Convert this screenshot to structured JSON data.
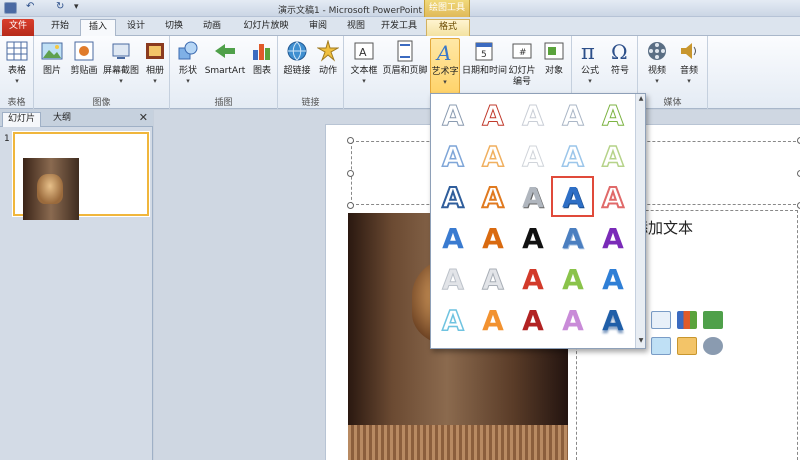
{
  "window": {
    "title": "演示文稿1 - Microsoft PowerPoint",
    "context_tab_group": "绘图工具"
  },
  "tabs": [
    "文件",
    "开始",
    "插入",
    "设计",
    "切换",
    "动画",
    "幻灯片放映",
    "审阅",
    "视图",
    "开发工具",
    "格式"
  ],
  "ribbon": {
    "groups": [
      {
        "label": "表格",
        "buttons": [
          "表格"
        ]
      },
      {
        "label": "图像",
        "buttons": [
          "图片",
          "剪贴画",
          "屏幕截图",
          "相册"
        ]
      },
      {
        "label": "插图",
        "buttons": [
          "形状",
          "SmartArt",
          "图表"
        ]
      },
      {
        "label": "链接",
        "buttons": [
          "超链接",
          "动作"
        ]
      },
      {
        "label": "",
        "buttons": [
          "文本框",
          "页眉和页脚",
          "艺术字",
          "日期和时间",
          "幻灯片\n编号",
          "对象"
        ]
      },
      {
        "label": "",
        "buttons": [
          "公式",
          "符号"
        ]
      },
      {
        "label": "媒体",
        "buttons": [
          "视频",
          "音频"
        ]
      }
    ]
  },
  "panel": {
    "tabs": [
      "幻灯片",
      "大纲"
    ],
    "slide_number": "1"
  },
  "slide": {
    "placeholder_text": "处添加文本"
  },
  "wordart": {
    "glyph": "A",
    "selected_index": 13
  },
  "colors": {
    "file_tab": "#c8351f",
    "ribbon_bg": "#f3f6fa",
    "selection": "#e04a3a"
  }
}
